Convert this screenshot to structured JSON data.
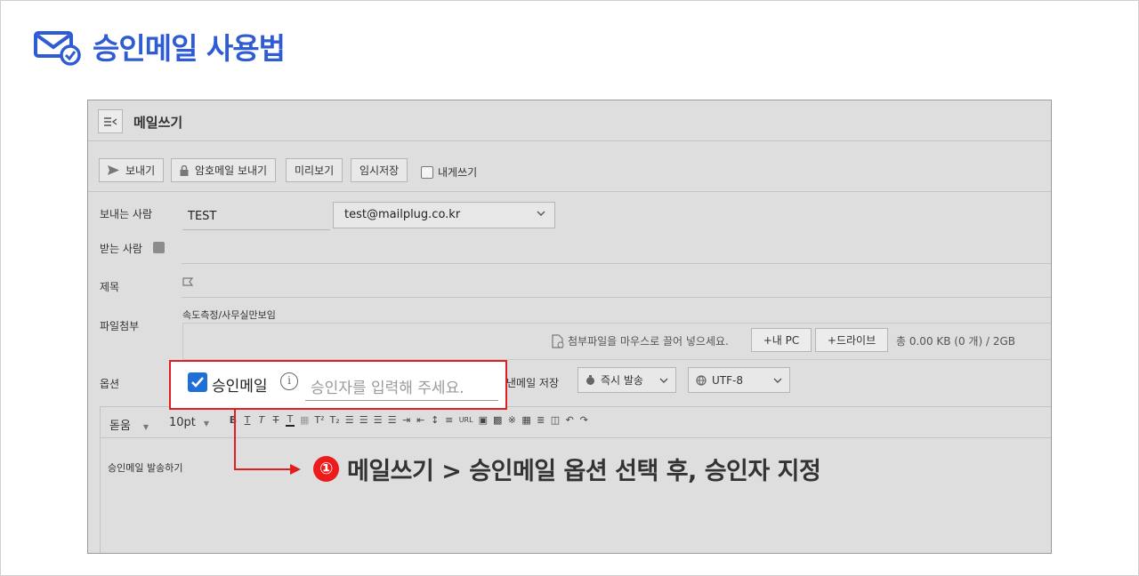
{
  "header": {
    "title": "승인메일 사용법",
    "icon": "mail-check-icon",
    "accent": "#2f5bd4"
  },
  "window": {
    "title": "메일쓰기",
    "menu_icon": "collapse-menu-icon"
  },
  "toolbar": {
    "send": "보내기",
    "secure_send": "암호메일 보내기",
    "preview": "미리보기",
    "draft": "임시저장",
    "to_self": "내게쓰기"
  },
  "form": {
    "sender_label": "보내는 사람",
    "sender_name": "TEST",
    "sender_email": "test@mailplug.co.kr",
    "recipient_label": "받는 사람",
    "subject_label": "제목",
    "attach_label": "파일첨부",
    "attached_file": "속도측정/사무실만보임",
    "drop_hint": "첨부파일을 마우스로 끌어 넣으세요.",
    "add_pc": "+내 PC",
    "add_drive": "+드라이브",
    "total_size": "총 0.00 KB (0 개) / 2GB",
    "options_label": "옵션",
    "save_sent": "낸메일 저장",
    "send_timing": "즉시 발송",
    "encoding": "UTF-8"
  },
  "editor": {
    "font_family": "돋움",
    "font_size": "10pt",
    "body": "승인메일 발송하기"
  },
  "highlight": {
    "approval_label": "승인메일",
    "approval_checked": true,
    "approver_placeholder": "승인자를 입력해 주세요.",
    "box_color": "#e02020"
  },
  "annotation": {
    "step": "①",
    "text": "메일쓰기 > 승인메일 옵션 선택 후, 승인자 지정",
    "step_color": "#ec1c1c"
  }
}
